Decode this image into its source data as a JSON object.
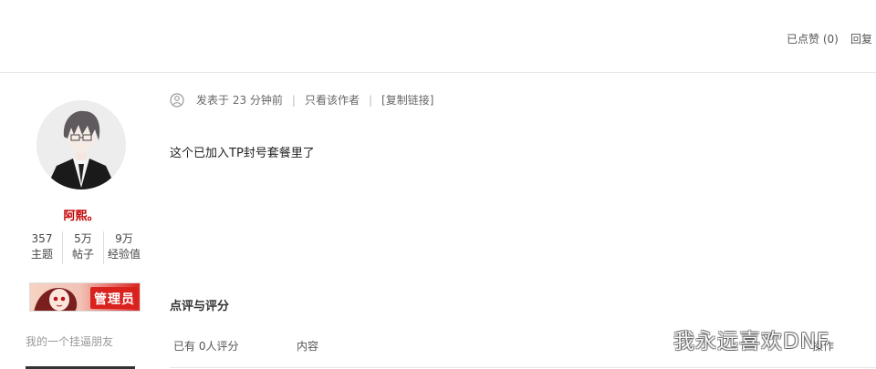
{
  "topbar": {
    "liked_label": "已点赞 (0)",
    "reply_label": "回复"
  },
  "author": {
    "name": "阿熙。",
    "stats": [
      {
        "value": "357",
        "label": "主题"
      },
      {
        "value": "5万",
        "label": "帖子"
      },
      {
        "value": "9万",
        "label": "经验值"
      }
    ],
    "badge_label": "管理员",
    "friend_label": "我的一个挂逼朋友"
  },
  "post": {
    "icon": "user-circle-icon",
    "posted_time": "发表于 23 分钟前",
    "only_author": "只看该作者",
    "copy_link": "[复制链接]",
    "separator": "|",
    "body": "这个已加入TP封号套餐里了"
  },
  "rating": {
    "title": "点评与评分",
    "col_count": "已有 0人评分",
    "col_content": "内容",
    "col_action": "操作"
  },
  "watermark": "我永远喜欢DNF",
  "colors": {
    "username": "#c40000",
    "divider": "#e6e6e6"
  }
}
